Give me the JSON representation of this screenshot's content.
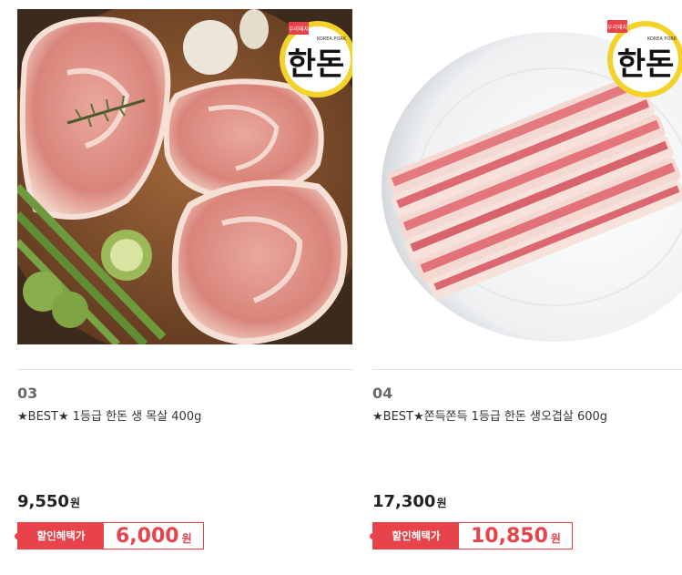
{
  "products": [
    {
      "rank": "03",
      "name": "★BEST★ 1등급 한돈 생 목살 400g",
      "price": "9,550",
      "won": "원",
      "sale_tag": "할인혜택가",
      "sale_price": "6,000",
      "badge_top": "우리돼지",
      "badge_en": "KOREA PORK",
      "badge_logo": "한돈"
    },
    {
      "rank": "04",
      "name": "★BEST★쫀득쫀득 1등급 한돈 생오겹살 600g",
      "price": "17,300",
      "won": "원",
      "sale_tag": "할인혜택가",
      "sale_price": "10,850",
      "badge_top": "우리돼지",
      "badge_en": "KOREA PORK",
      "badge_logo": "한돈"
    }
  ],
  "colors": {
    "accent": "#e8424b",
    "divider": "#e2e2e2",
    "rank": "#6a6a6a"
  }
}
